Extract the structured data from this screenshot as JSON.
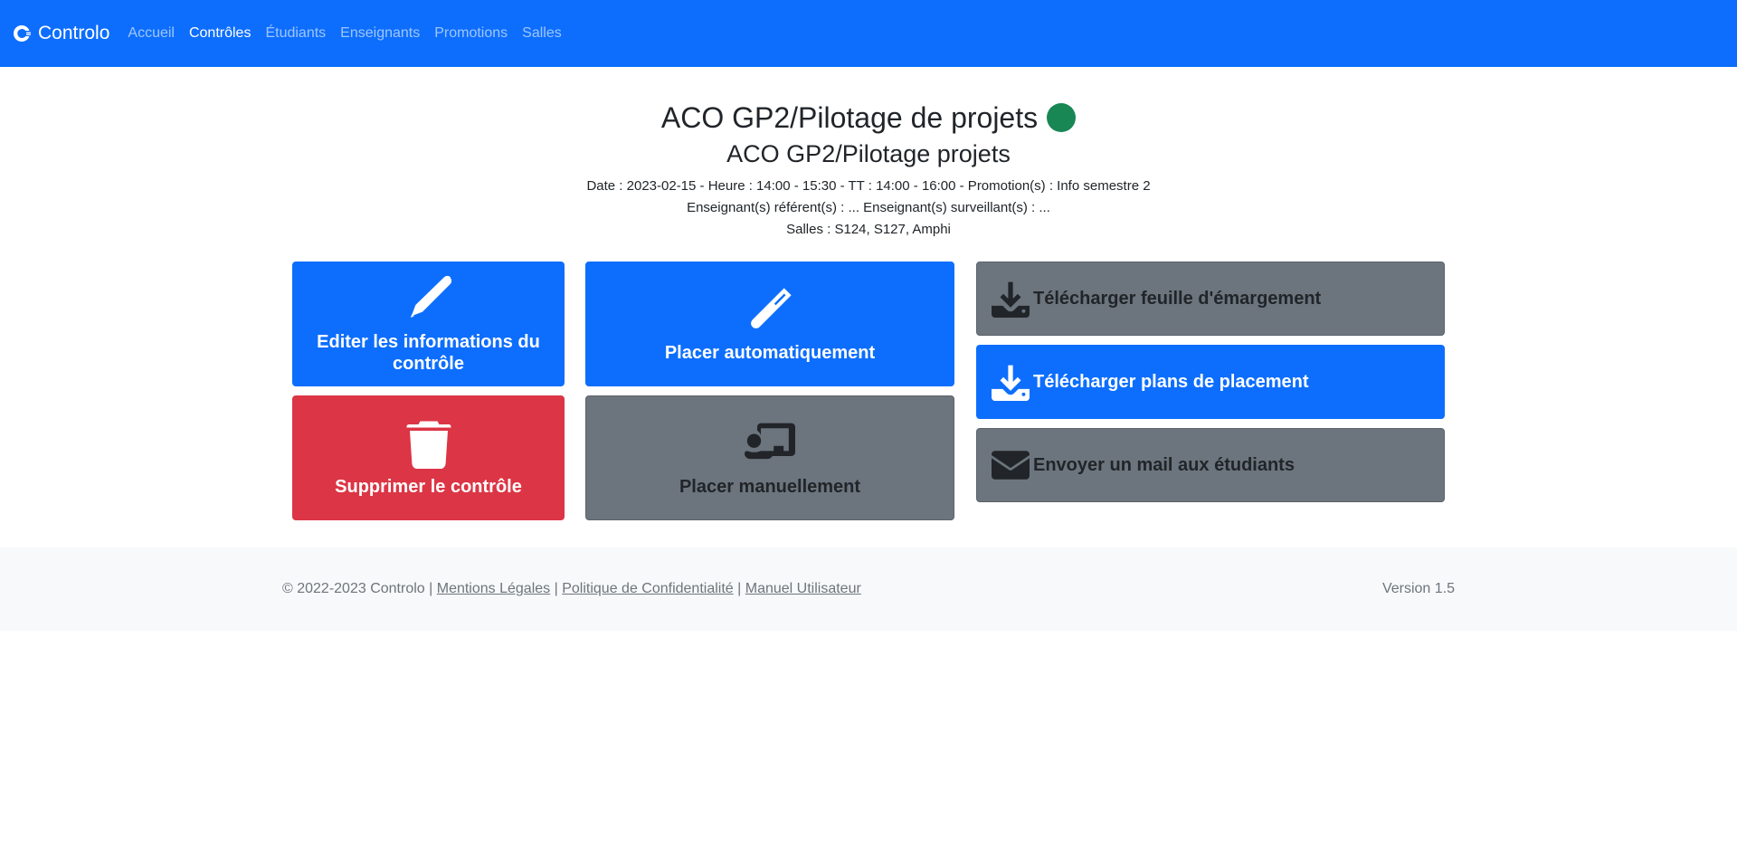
{
  "navbar": {
    "brand": "Controlo",
    "links": [
      {
        "label": "Accueil",
        "active": false
      },
      {
        "label": "Contrôles",
        "active": true
      },
      {
        "label": "Étudiants",
        "active": false
      },
      {
        "label": "Enseignants",
        "active": false
      },
      {
        "label": "Promotions",
        "active": false
      },
      {
        "label": "Salles",
        "active": false
      }
    ]
  },
  "header": {
    "title": "ACO GP2/Pilotage de projets",
    "status_color": "#198754",
    "subtitle": "ACO GP2/Pilotage projets",
    "details_line": "Date : 2023-02-15 - Heure : 14:00 - 15:30 - TT : 14:00 - 16:00 - Promotion(s) : Info semestre 2",
    "teachers_line": "Enseignant(s) référent(s) : ... Enseignant(s) surveillant(s) : ...",
    "rooms_line": "Salles : S124, S127, Amphi"
  },
  "actions": {
    "edit": {
      "label": "Editer les informations du contrôle",
      "icon": "pencil-icon"
    },
    "auto_place": {
      "label": "Placer automatiquement",
      "icon": "magic-wand-icon"
    },
    "delete": {
      "label": "Supprimer le contrôle",
      "icon": "trash-icon"
    },
    "manual_place": {
      "label": "Placer manuellement",
      "icon": "presentation-icon"
    },
    "download_sheet": {
      "label": "Télécharger feuille d'émargement",
      "icon": "download-icon"
    },
    "download_plans": {
      "label": "Télécharger plans de placement",
      "icon": "download-icon"
    },
    "send_mail": {
      "label": "Envoyer un mail aux étudiants",
      "icon": "envelope-icon"
    }
  },
  "footer": {
    "copyright": "© 2022-2023 Controlo",
    "separator": "|",
    "links": [
      "Mentions Légales",
      "Politique de Confidentialité",
      "Manuel Utilisateur"
    ],
    "version": "Version 1.5"
  },
  "colors": {
    "primary": "#0d6efd",
    "danger": "#dc3545",
    "secondary": "#6c757d",
    "success": "#198754",
    "footer_bg": "#f8f9fa"
  }
}
